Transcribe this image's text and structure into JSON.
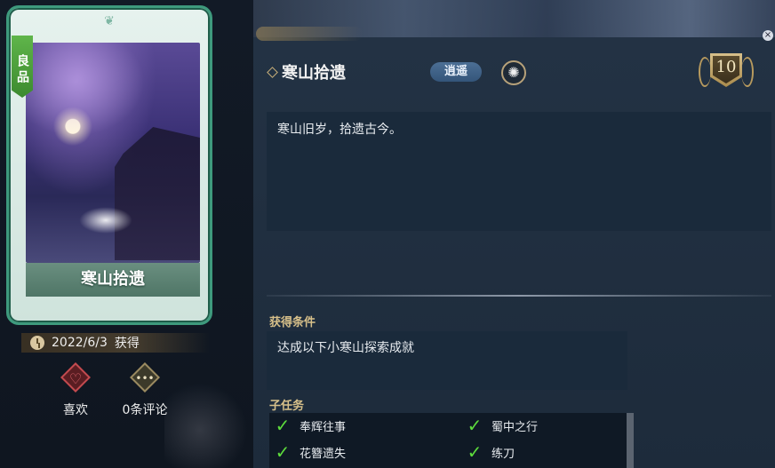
{
  "card": {
    "rarity": "良品",
    "name": "寒山拾遗"
  },
  "meta": {
    "date": "2022/6/3",
    "obtained": "获得"
  },
  "actions": {
    "like_label": "喜欢",
    "comment_label": "0条评论"
  },
  "detail": {
    "title": "寒山拾遗",
    "tag": "逍遥",
    "level": "10",
    "description": "寒山旧岁，拾遗古今。",
    "condition_label": "获得条件",
    "condition_text": "达成以下小寒山探索成就",
    "subtasks_label": "子任务",
    "subtasks": [
      {
        "label": "奉辉往事",
        "done": true
      },
      {
        "label": "蜀中之行",
        "done": true
      },
      {
        "label": "花簪遗失",
        "done": true
      },
      {
        "label": "练刀",
        "done": true
      }
    ]
  },
  "colors": {
    "rarity_green": "#4aa03a",
    "check_green": "#5ddc3c",
    "label_gold": "#d7c08a",
    "panel_bg": "#233244"
  },
  "icons": {
    "date": "clock-icon",
    "like": "heart-icon",
    "comment": "speech-bubble-icon",
    "tag_badge": "pinwheel-icon",
    "level": "laurel-shield-icon"
  }
}
